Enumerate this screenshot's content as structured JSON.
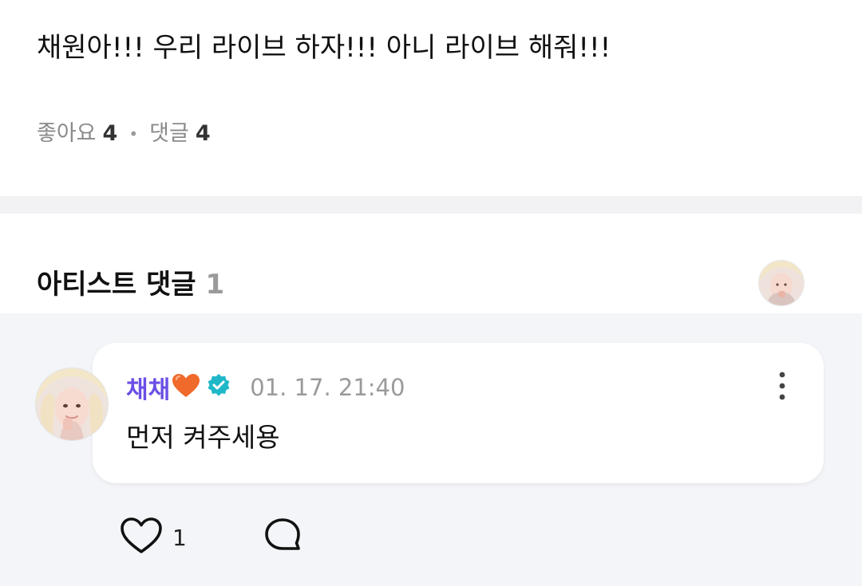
{
  "post": {
    "text": "채원아!!! 우리 라이브 하자!!! 아니 라이브 해줘!!!",
    "likes_label": "좋아요",
    "likes_count": "4",
    "comments_label": "댓글",
    "comments_count": "4"
  },
  "artist_section": {
    "title": "아티스트 댓글",
    "count": "1"
  },
  "comment": {
    "author": "채채",
    "timestamp": "01. 17. 21:40",
    "body": "먼저 켜주세용",
    "like_count": "1",
    "icons": {
      "author_decoration": "orange-heart-emoji",
      "verified": "verified-badge-icon",
      "more": "more-vertical-icon",
      "like": "heart-outline-icon",
      "reply": "speech-bubble-icon"
    }
  },
  "colors": {
    "author_name": "#6b4ee6",
    "verified_badge": "#1fb8c9",
    "heart_emoji": "#f06a2b",
    "muted_text": "#9a9a9a",
    "comment_bg": "#f4f5f8"
  }
}
